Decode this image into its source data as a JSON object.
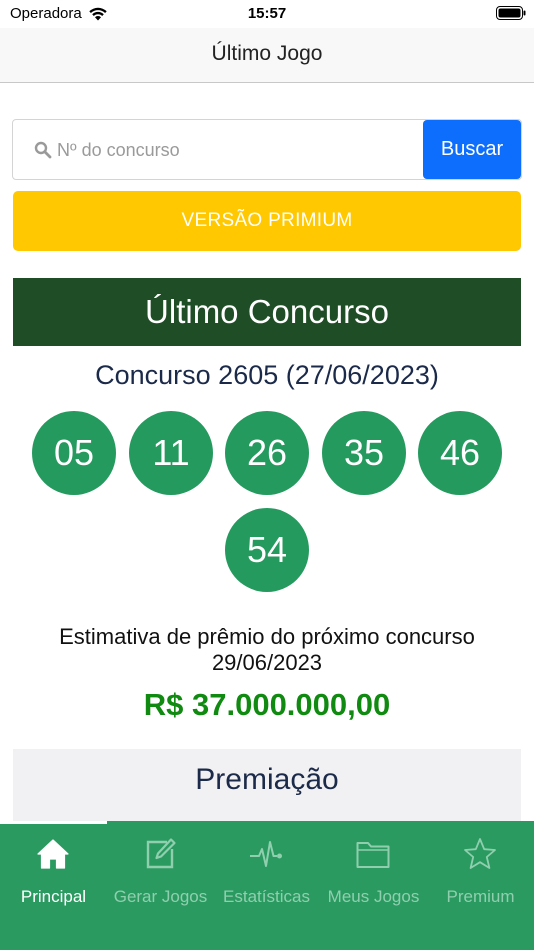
{
  "status_bar": {
    "carrier": "Operadora",
    "time": "15:57"
  },
  "nav": {
    "title": "Último Jogo"
  },
  "search": {
    "placeholder": "Nº do concurso",
    "button_label": "Buscar"
  },
  "premium_button": "VERSÃO PRIMIUM",
  "latest": {
    "header": "Último Concurso",
    "contest": "Concurso 2605 (27/06/2023)",
    "numbers": [
      "05",
      "11",
      "26",
      "35",
      "46",
      "54"
    ]
  },
  "estimate": {
    "label": "Estimativa de prêmio do próximo concurso",
    "date": "29/06/2023",
    "value": "R$ 37.000.000,00"
  },
  "prizes_header": "Premiação",
  "colors": {
    "header_green": "#1f4d26",
    "ball_green": "#259a5e",
    "prize_green": "#108a10",
    "tabbar_green": "#2a9a60",
    "premium_yellow": "#ffc800",
    "search_blue": "#0d6efd"
  },
  "tabs": [
    {
      "label": "Principal",
      "icon": "home-icon",
      "active": true
    },
    {
      "label": "Gerar Jogos",
      "icon": "edit-icon",
      "active": false
    },
    {
      "label": "Estatísticas",
      "icon": "pulse-icon",
      "active": false
    },
    {
      "label": "Meus Jogos",
      "icon": "folder-icon",
      "active": false
    },
    {
      "label": "Premium",
      "icon": "star-icon",
      "active": false
    }
  ]
}
